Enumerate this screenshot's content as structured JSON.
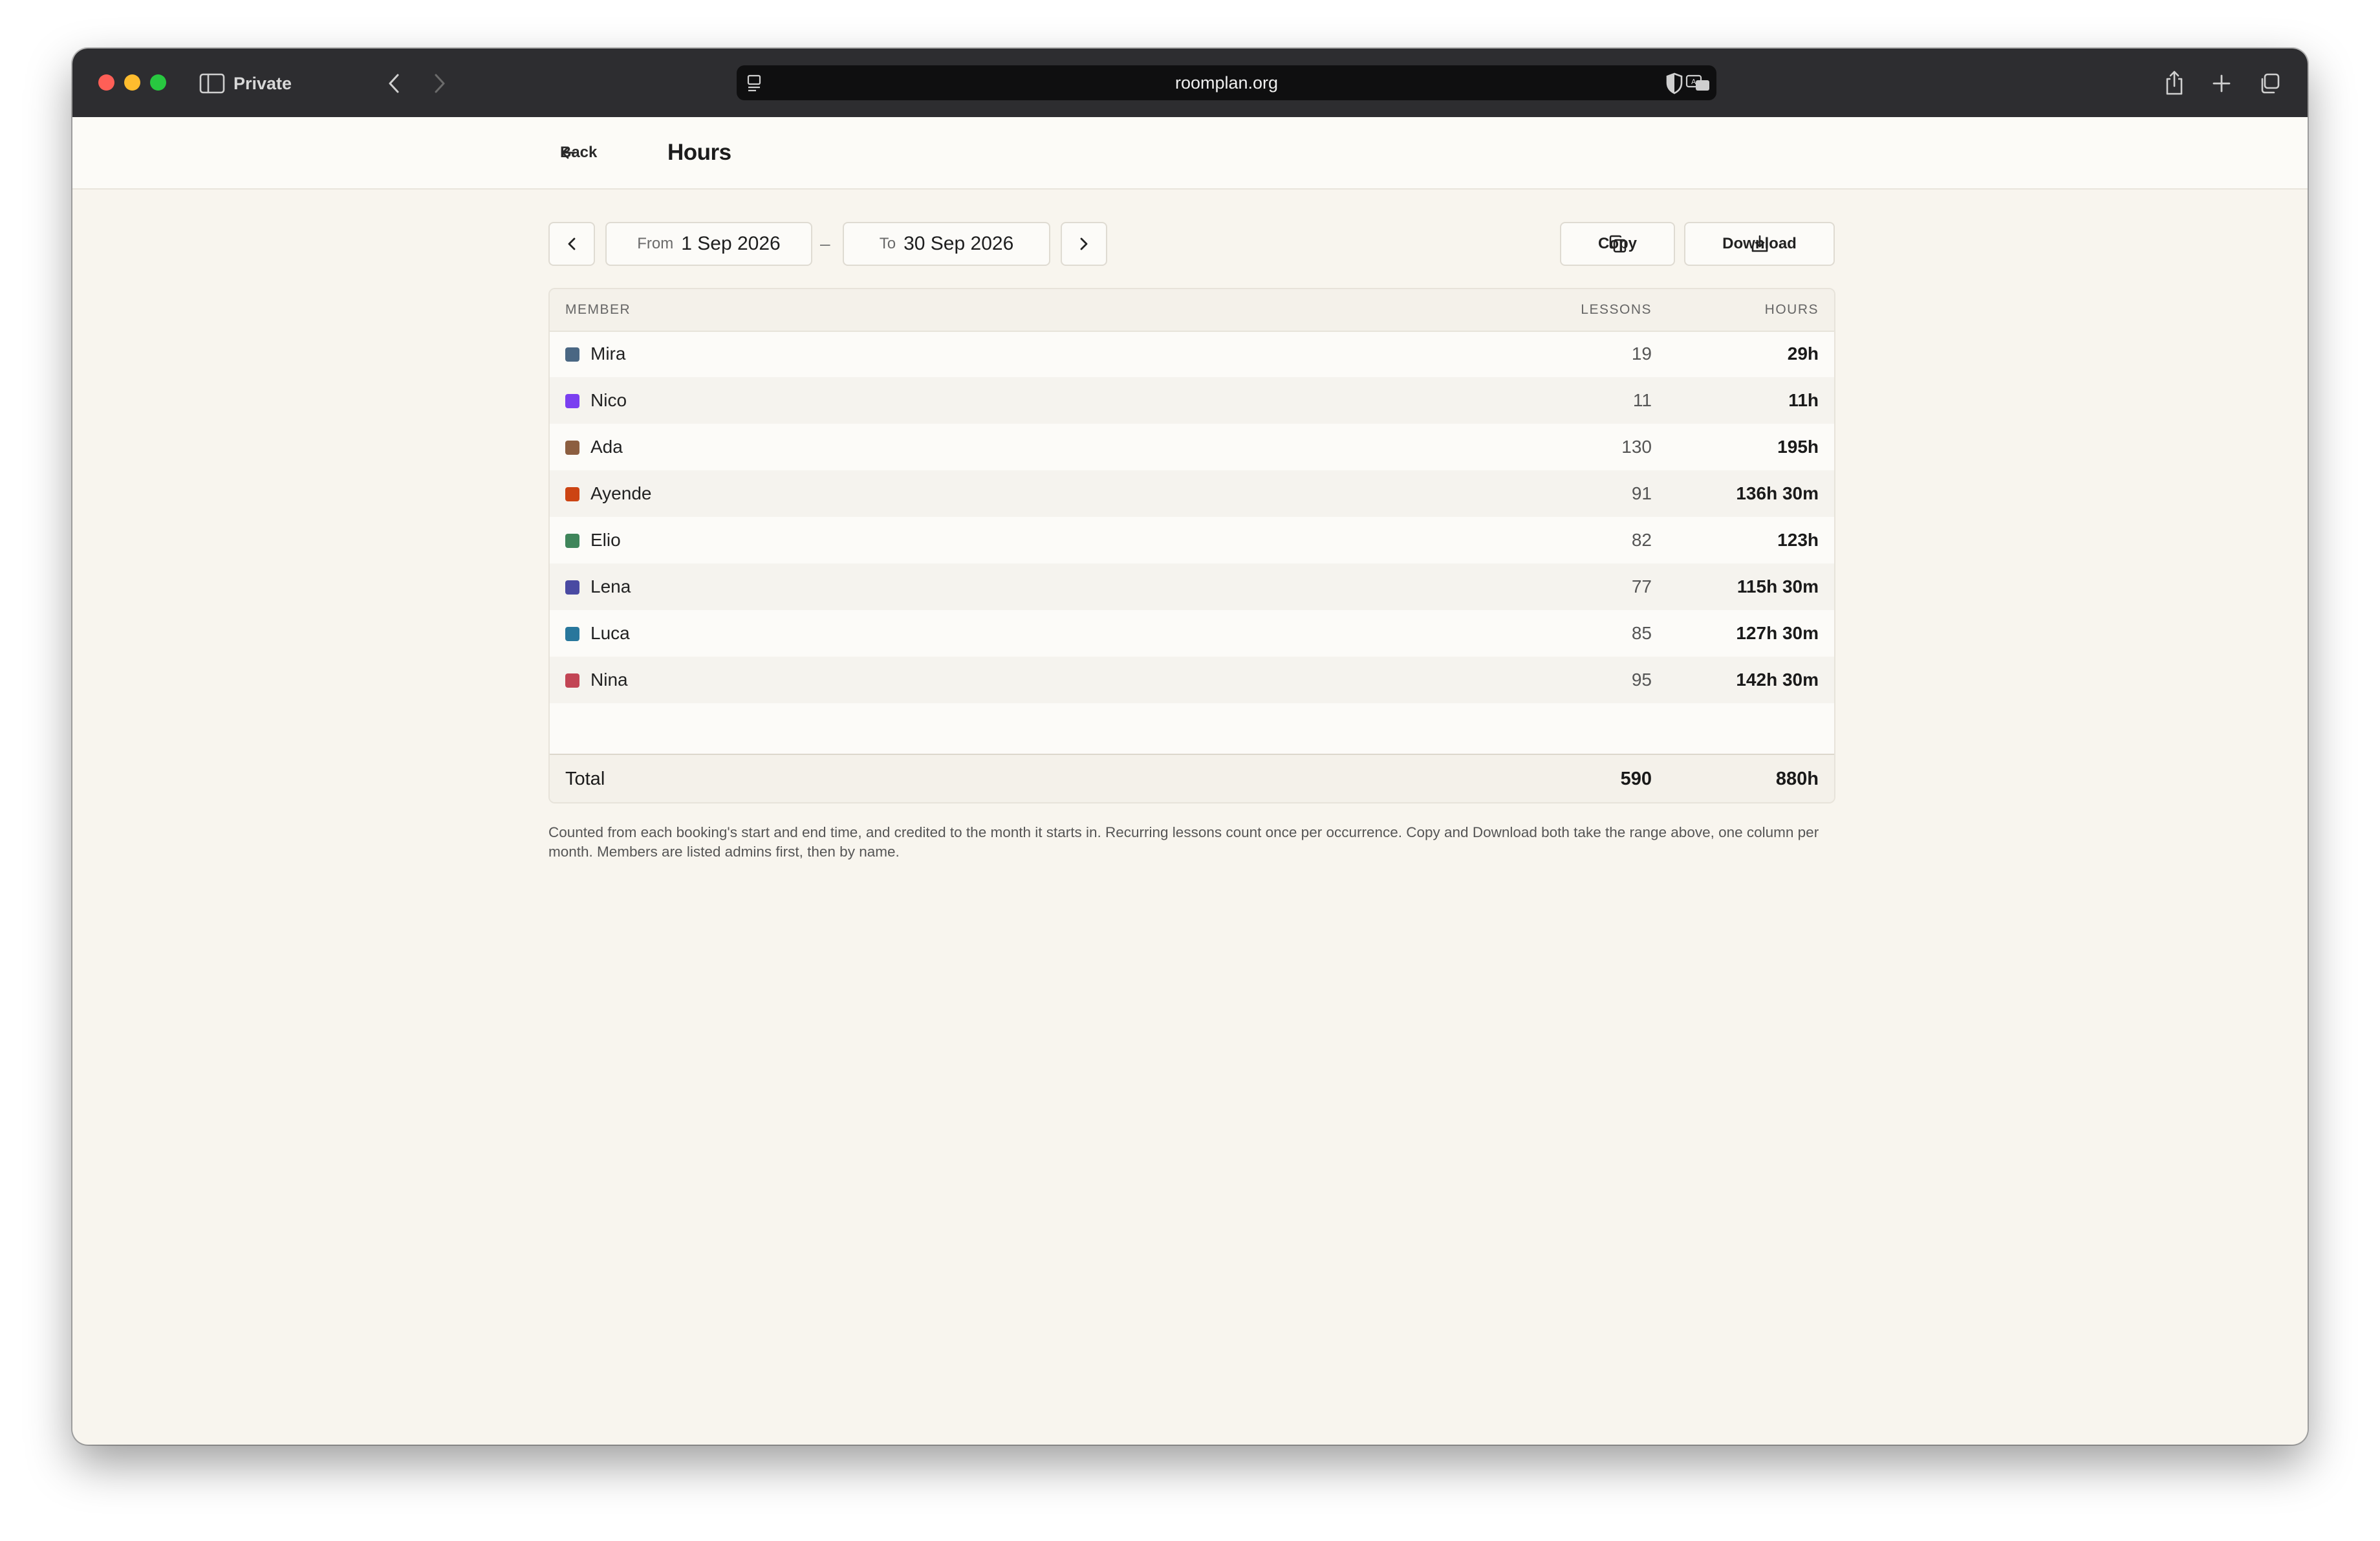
{
  "browser": {
    "mode_label": "Private",
    "url": "roomplan.org"
  },
  "header": {
    "back_label": "Back",
    "title": "Hours"
  },
  "range": {
    "from_prefix": "From",
    "from_value": "1 Sep 2026",
    "separator": "–",
    "to_prefix": "To",
    "to_value": "30 Sep 2026"
  },
  "actions": {
    "copy_label": "Copy",
    "download_label": "Download"
  },
  "table": {
    "columns": {
      "member": "MEMBER",
      "lessons": "LESSONS",
      "hours": "HOURS"
    },
    "rows": [
      {
        "name": "Mira",
        "color": "#4a6783",
        "lessons": "19",
        "hours": "29h"
      },
      {
        "name": "Nico",
        "color": "#7a3ff0",
        "lessons": "11",
        "hours": "11h"
      },
      {
        "name": "Ada",
        "color": "#8c5e40",
        "lessons": "130",
        "hours": "195h"
      },
      {
        "name": "Ayende",
        "color": "#cc4413",
        "lessons": "91",
        "hours": "136h 30m"
      },
      {
        "name": "Elio",
        "color": "#3f855a",
        "lessons": "82",
        "hours": "123h"
      },
      {
        "name": "Lena",
        "color": "#4a4aa2",
        "lessons": "77",
        "hours": "115h 30m"
      },
      {
        "name": "Luca",
        "color": "#28779c",
        "lessons": "85",
        "hours": "127h 30m"
      },
      {
        "name": "Nina",
        "color": "#c24554",
        "lessons": "95",
        "hours": "142h 30m"
      }
    ],
    "total": {
      "label": "Total",
      "lessons": "590",
      "hours": "880h"
    }
  },
  "footnote": "Counted from each booking's start and end time, and credited to the month it starts in. Recurring lessons count once per occurrence. Copy and Download both take the range above, one column per month. Members are listed admins first, then by name."
}
